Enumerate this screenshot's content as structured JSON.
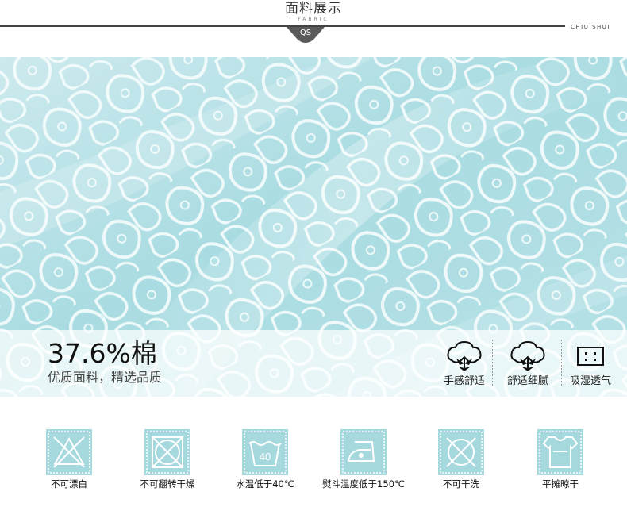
{
  "header": {
    "title": "面料展示",
    "subtitle": "FABRIC",
    "badge": "QS",
    "brand": "CHIU SHUI",
    "line_color": "#444444",
    "badge_color": "#5a5a5a"
  },
  "photo": {
    "alt_colors": {
      "base": "#a8dbe0",
      "lace": "#f4fbfb"
    }
  },
  "info": {
    "percentage": "37.6%棉",
    "subtitle": "优质面料，精选品质"
  },
  "features": [
    {
      "icon": "cotton-icon",
      "label": "手感舒适"
    },
    {
      "icon": "cotton-icon",
      "label": "舒适细腻"
    },
    {
      "icon": "breathable-icon",
      "label": "吸湿透气"
    }
  ],
  "care": [
    {
      "icon": "no-bleach-icon",
      "label": "不可漂白"
    },
    {
      "icon": "no-tumble-dry-icon",
      "label": "不可翻转干燥"
    },
    {
      "icon": "wash-40-icon",
      "label": "水温低于40℃",
      "temp": "40"
    },
    {
      "icon": "iron-150-icon",
      "label": "熨斗温度低于150℃"
    },
    {
      "icon": "no-dry-clean-icon",
      "label": "不可干洗"
    },
    {
      "icon": "flat-dry-icon",
      "label": "平摊晾干"
    }
  ],
  "care_color": "#9fd7dc"
}
